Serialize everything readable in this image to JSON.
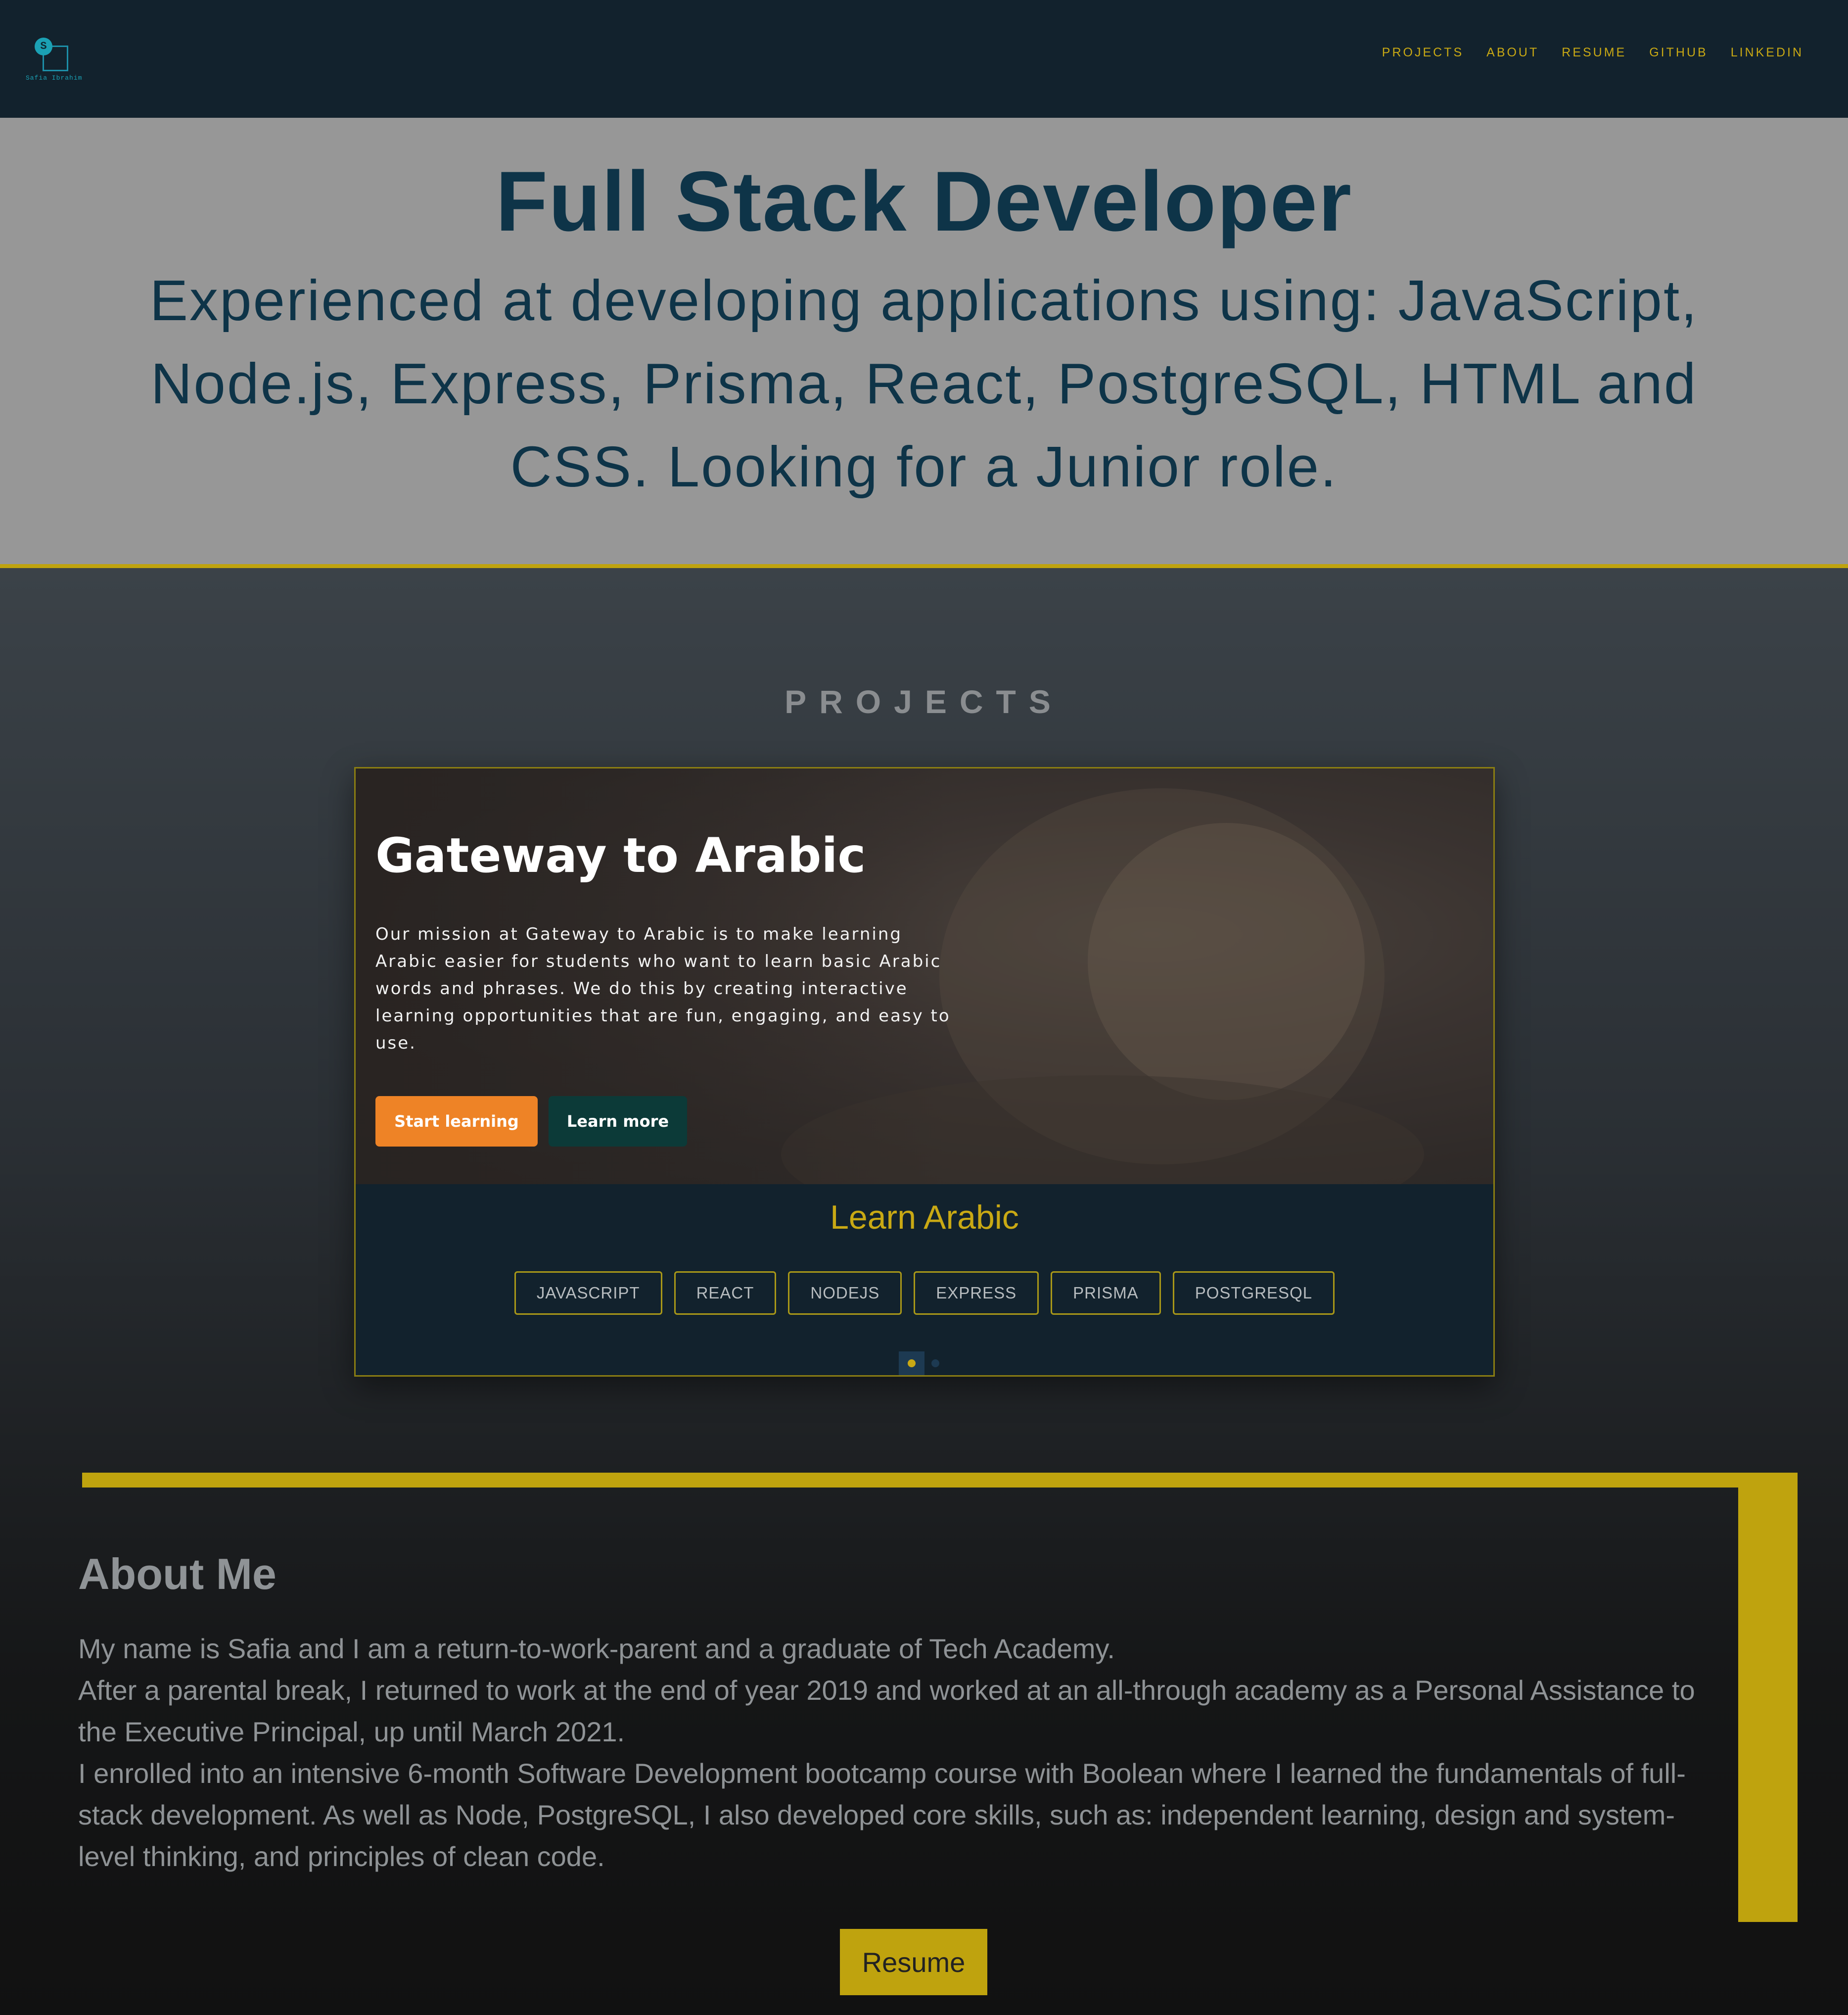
{
  "nav": {
    "logo_letter": "S",
    "logo_text": "Safia Ibrahim",
    "links": [
      "PROJECTS",
      "ABOUT",
      "RESUME",
      "GITHUB",
      "LINKEDIN"
    ]
  },
  "hero": {
    "title": "Full Stack Developer",
    "subtitle": "Experienced at developing applications using: JavaScript, Node.js, Express, Prisma, React, PostgreSQL, HTML and CSS. Looking for a Junior role."
  },
  "projects": {
    "section_title": "PROJECTS",
    "card": {
      "headline": "Gateway to Arabic",
      "description": "Our mission at Gateway to Arabic is to make learning Arabic easier for students who want to learn basic Arabic words and phrases. We do this by creating interactive learning opportunities that are fun, engaging, and easy to use.",
      "primary_button": "Start learning",
      "secondary_button": "Learn more",
      "project_name": "Learn Arabic",
      "tags": [
        "JAVASCRIPT",
        "REACT",
        "NODEJS",
        "EXPRESS",
        "PRISMA",
        "POSTGRESQL"
      ],
      "carousel_active_index": 1,
      "carousel_count": 2
    }
  },
  "about": {
    "title": "About Me",
    "paragraphs": [
      "My name is Safia and I am a return-to-work-parent and a graduate of Tech Academy.",
      "After a parental break, I returned to work at the end of year 2019 and worked at an all-through academy as a Personal Assistance to the Executive Principal, up until March 2021.",
      "I enrolled into an intensive 6-month Software Development bootcamp course with Boolean where I learned the fundamentals of full-stack development. As well as Node, PostgreSQL, I also developed core skills, such as: independent learning, design and system-level thinking, and principles of clean code."
    ],
    "resume_button": "Resume"
  },
  "colors": {
    "nav_bg": "#12222d",
    "accent_gold": "#bfa30e",
    "hero_bg": "#979797",
    "hero_text": "#0e3448",
    "button_orange": "#ee8326",
    "button_dark_teal": "#0c3a38"
  }
}
